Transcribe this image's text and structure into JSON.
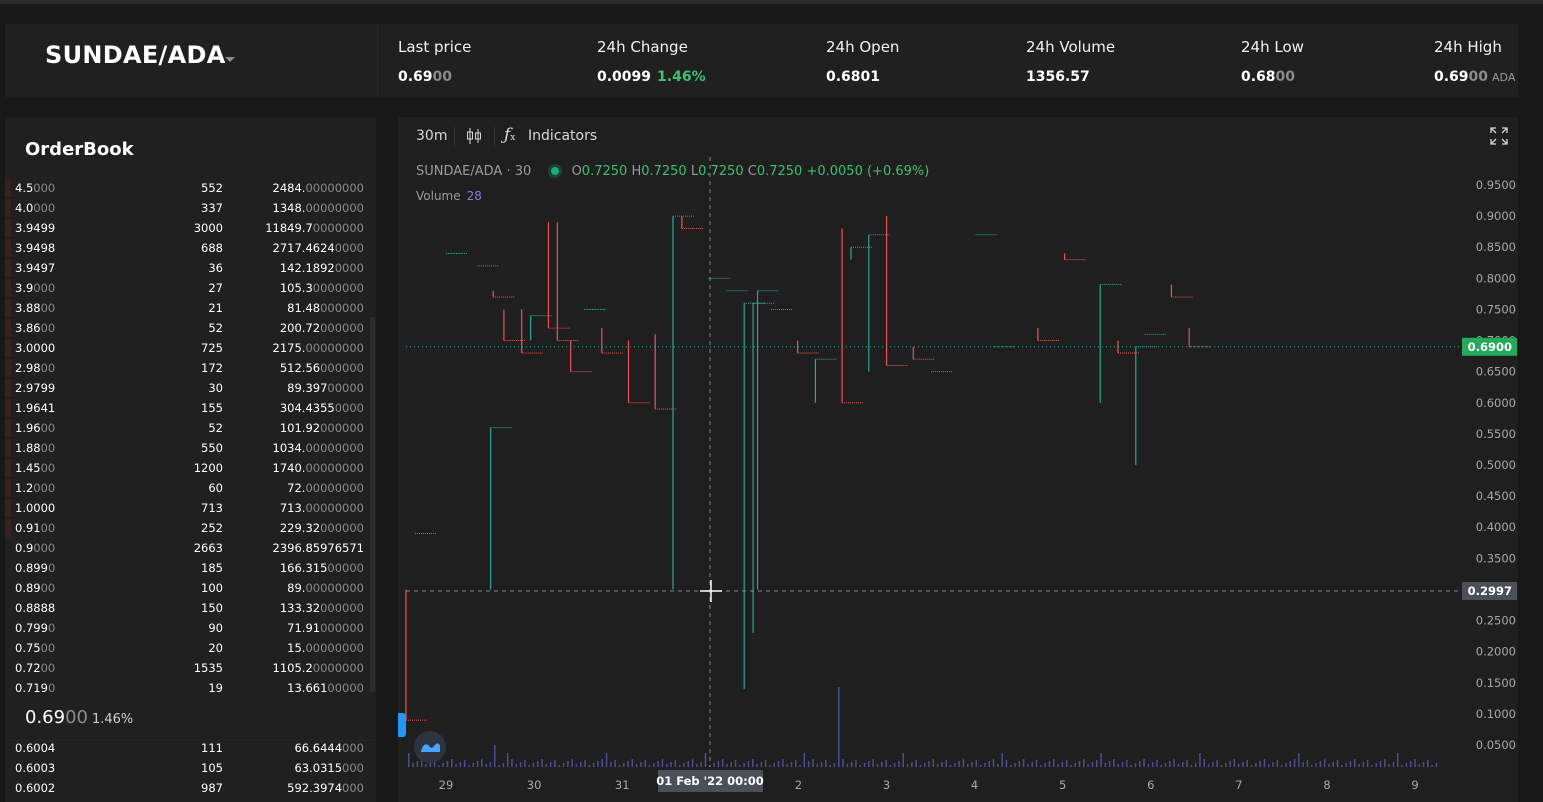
{
  "header": {
    "pair": "SUNDAE/ADA",
    "stats": [
      {
        "label": "Last price",
        "value": "0.69",
        "value_dim": "00"
      },
      {
        "label": "24h Change",
        "value": "0.0099",
        "change": "1.46%"
      },
      {
        "label": "24h Open",
        "value": "0.6801"
      },
      {
        "label": "24h Volume",
        "value": "1356.57"
      },
      {
        "label": "24h Low",
        "value": "0.68",
        "value_dim": "00"
      },
      {
        "label": "24h High",
        "value": "0.69",
        "value_dim": "00",
        "unit": "ADA"
      }
    ]
  },
  "orderbook": {
    "title": "OrderBook",
    "asks": [
      {
        "p": "4.5",
        "pd": "000",
        "q": "552",
        "t": "2484.",
        "td": "00000000",
        "depth": 1.0
      },
      {
        "p": "4.0",
        "pd": "000",
        "q": "337",
        "t": "1348.",
        "td": "00000000",
        "depth": 1.0
      },
      {
        "p": "3.9499",
        "pd": "",
        "q": "3000",
        "t": "11849.7",
        "td": "0000000",
        "depth": 1.0
      },
      {
        "p": "3.9498",
        "pd": "",
        "q": "688",
        "t": "2717.4624",
        "td": "0000",
        "depth": 1.0
      },
      {
        "p": "3.9497",
        "pd": "",
        "q": "36",
        "t": "142.1892",
        "td": "0000",
        "depth": 1.0
      },
      {
        "p": "3.9",
        "pd": "000",
        "q": "27",
        "t": "105.3",
        "td": "0000000",
        "depth": 1.0
      },
      {
        "p": "3.88",
        "pd": "00",
        "q": "21",
        "t": "81.48",
        "td": "000000",
        "depth": 1.0
      },
      {
        "p": "3.86",
        "pd": "00",
        "q": "52",
        "t": "200.72",
        "td": "000000",
        "depth": 1.0
      },
      {
        "p": "3.0000",
        "pd": "",
        "q": "725",
        "t": "2175.",
        "td": "00000000",
        "depth": 1.0
      },
      {
        "p": "2.98",
        "pd": "00",
        "q": "172",
        "t": "512.56",
        "td": "000000",
        "depth": 1.0
      },
      {
        "p": "2.9799",
        "pd": "",
        "q": "30",
        "t": "89.397",
        "td": "00000",
        "depth": 1.0
      },
      {
        "p": "1.9641",
        "pd": "",
        "q": "155",
        "t": "304.4355",
        "td": "0000",
        "depth": 1.0
      },
      {
        "p": "1.96",
        "pd": "00",
        "q": "52",
        "t": "101.92",
        "td": "000000",
        "depth": 1.0
      },
      {
        "p": "1.88",
        "pd": "00",
        "q": "550",
        "t": "1034.",
        "td": "00000000",
        "depth": 1.0
      },
      {
        "p": "1.45",
        "pd": "00",
        "q": "1200",
        "t": "1740.",
        "td": "00000000",
        "depth": 1.0
      },
      {
        "p": "1.2",
        "pd": "000",
        "q": "60",
        "t": "72.",
        "td": "00000000",
        "depth": 1.0
      },
      {
        "p": "1.0000",
        "pd": "",
        "q": "713",
        "t": "713.",
        "td": "00000000",
        "depth": 1.0
      },
      {
        "p": "0.91",
        "pd": "00",
        "q": "252",
        "t": "229.32",
        "td": "000000",
        "depth": 1.0
      },
      {
        "p": "0.9",
        "pd": "000",
        "q": "2663",
        "t": "2396.85976571",
        "td": "",
        "depth": 0
      },
      {
        "p": "0.899",
        "pd": "0",
        "q": "185",
        "t": "166.315",
        "td": "00000",
        "depth": 0
      },
      {
        "p": "0.89",
        "pd": "00",
        "q": "100",
        "t": "89.",
        "td": "00000000",
        "depth": 0
      },
      {
        "p": "0.8888",
        "pd": "",
        "q": "150",
        "t": "133.32",
        "td": "000000",
        "depth": 0
      },
      {
        "p": "0.799",
        "pd": "0",
        "q": "90",
        "t": "71.91",
        "td": "000000",
        "depth": 0
      },
      {
        "p": "0.75",
        "pd": "00",
        "q": "20",
        "t": "15.",
        "td": "00000000",
        "depth": 0
      },
      {
        "p": "0.72",
        "pd": "00",
        "q": "1535",
        "t": "1105.2",
        "td": "0000000",
        "depth": 0
      },
      {
        "p": "0.719",
        "pd": "0",
        "q": "19",
        "t": "13.661",
        "td": "00000",
        "depth": 0
      }
    ],
    "mid": {
      "price": "0.69",
      "price_dim": "00",
      "change": "1.46%"
    },
    "bids": [
      {
        "p": "0.6004",
        "pd": "",
        "q": "111",
        "t": "66.6444",
        "td": "000"
      },
      {
        "p": "0.6003",
        "pd": "",
        "q": "105",
        "t": "63.0315",
        "td": "000"
      },
      {
        "p": "0.6002",
        "pd": "",
        "q": "987",
        "t": "592.3974",
        "td": "000"
      }
    ]
  },
  "chart": {
    "toolbar": {
      "interval": "30m",
      "indicators": "Indicators"
    },
    "legend": {
      "symbol": "SUNDAE/ADA",
      "interval": "30",
      "o_label": "O",
      "o": "0.7250",
      "h_label": "H",
      "h": "0.7250",
      "l_label": "L",
      "l": "0.7250",
      "c_label": "C",
      "c": "0.7250",
      "change": "+0.0050 (+0.69%)",
      "volume_label": "Volume",
      "volume": "28"
    },
    "price_ticks": [
      "0.9500",
      "0.9000",
      "0.8500",
      "0.8000",
      "0.7500",
      "0.7000",
      "0.6500",
      "0.6000",
      "0.5500",
      "0.5000",
      "0.4500",
      "0.4000",
      "0.3500",
      "0.3000",
      "0.2500",
      "0.2000",
      "0.1500",
      "0.1000",
      "0.0500"
    ],
    "time_ticks": [
      "29",
      "30",
      "31",
      "",
      "2",
      "3",
      "4",
      "5",
      "6",
      "7",
      "8",
      "9"
    ],
    "last_price_tag": "0.6900",
    "crosshair_price": "0.2997",
    "crosshair_time": "01 Feb '22   00:00",
    "colors": {
      "up": "#26a69a",
      "down": "#ef5350",
      "volume": "#4b4f8f"
    }
  },
  "chart_data": {
    "type": "line",
    "title": "",
    "xlabel": "",
    "ylabel": "",
    "ylim": [
      0.0,
      0.97
    ],
    "x_ticks": [
      "29",
      "30",
      "31",
      "01 Feb '22",
      "2",
      "3",
      "4",
      "5",
      "6",
      "7",
      "8",
      "9"
    ],
    "series": [
      {
        "values": [
          [
            0.0,
            0.3,
            0.09
          ],
          [
            0.1,
            0.39,
            0.39
          ],
          [
            0.45,
            0.84,
            0.84
          ],
          [
            0.8,
            0.82,
            0.82
          ],
          [
            0.95,
            0.3,
            0.56
          ],
          [
            0.98,
            0.78,
            0.77
          ],
          [
            1.1,
            0.75,
            0.7
          ],
          [
            1.3,
            0.75,
            0.68
          ],
          [
            1.4,
            0.7,
            0.74
          ],
          [
            1.6,
            0.89,
            0.72
          ],
          [
            1.7,
            0.89,
            0.7
          ],
          [
            1.85,
            0.7,
            0.65
          ],
          [
            2.0,
            0.75,
            0.75
          ],
          [
            2.2,
            0.72,
            0.68
          ],
          [
            2.5,
            0.7,
            0.6
          ],
          [
            2.8,
            0.71,
            0.59
          ],
          [
            3.0,
            0.3,
            0.9
          ],
          [
            3.1,
            0.9,
            0.88
          ],
          [
            3.4,
            0.8,
            0.8
          ],
          [
            3.6,
            0.78,
            0.78
          ],
          [
            3.8,
            0.14,
            0.76
          ],
          [
            3.9,
            0.23,
            0.76
          ],
          [
            3.95,
            0.3,
            0.78
          ],
          [
            4.1,
            0.75,
            0.75
          ],
          [
            4.4,
            0.7,
            0.68
          ],
          [
            4.6,
            0.6,
            0.67
          ],
          [
            4.9,
            0.88,
            0.6
          ],
          [
            5.0,
            0.83,
            0.85
          ],
          [
            5.2,
            0.65,
            0.87
          ],
          [
            5.4,
            0.9,
            0.66
          ],
          [
            5.7,
            0.69,
            0.67
          ],
          [
            5.9,
            0.65,
            0.65
          ],
          [
            6.4,
            0.87,
            0.87
          ],
          [
            6.6,
            0.69,
            0.69
          ],
          [
            7.1,
            0.72,
            0.7
          ],
          [
            7.4,
            0.84,
            0.83
          ],
          [
            7.8,
            0.6,
            0.79
          ],
          [
            8.0,
            0.7,
            0.68
          ],
          [
            8.2,
            0.5,
            0.69
          ],
          [
            8.3,
            0.71,
            0.71
          ],
          [
            8.6,
            0.79,
            0.77
          ],
          [
            8.8,
            0.72,
            0.69
          ]
        ]
      }
    ]
  }
}
